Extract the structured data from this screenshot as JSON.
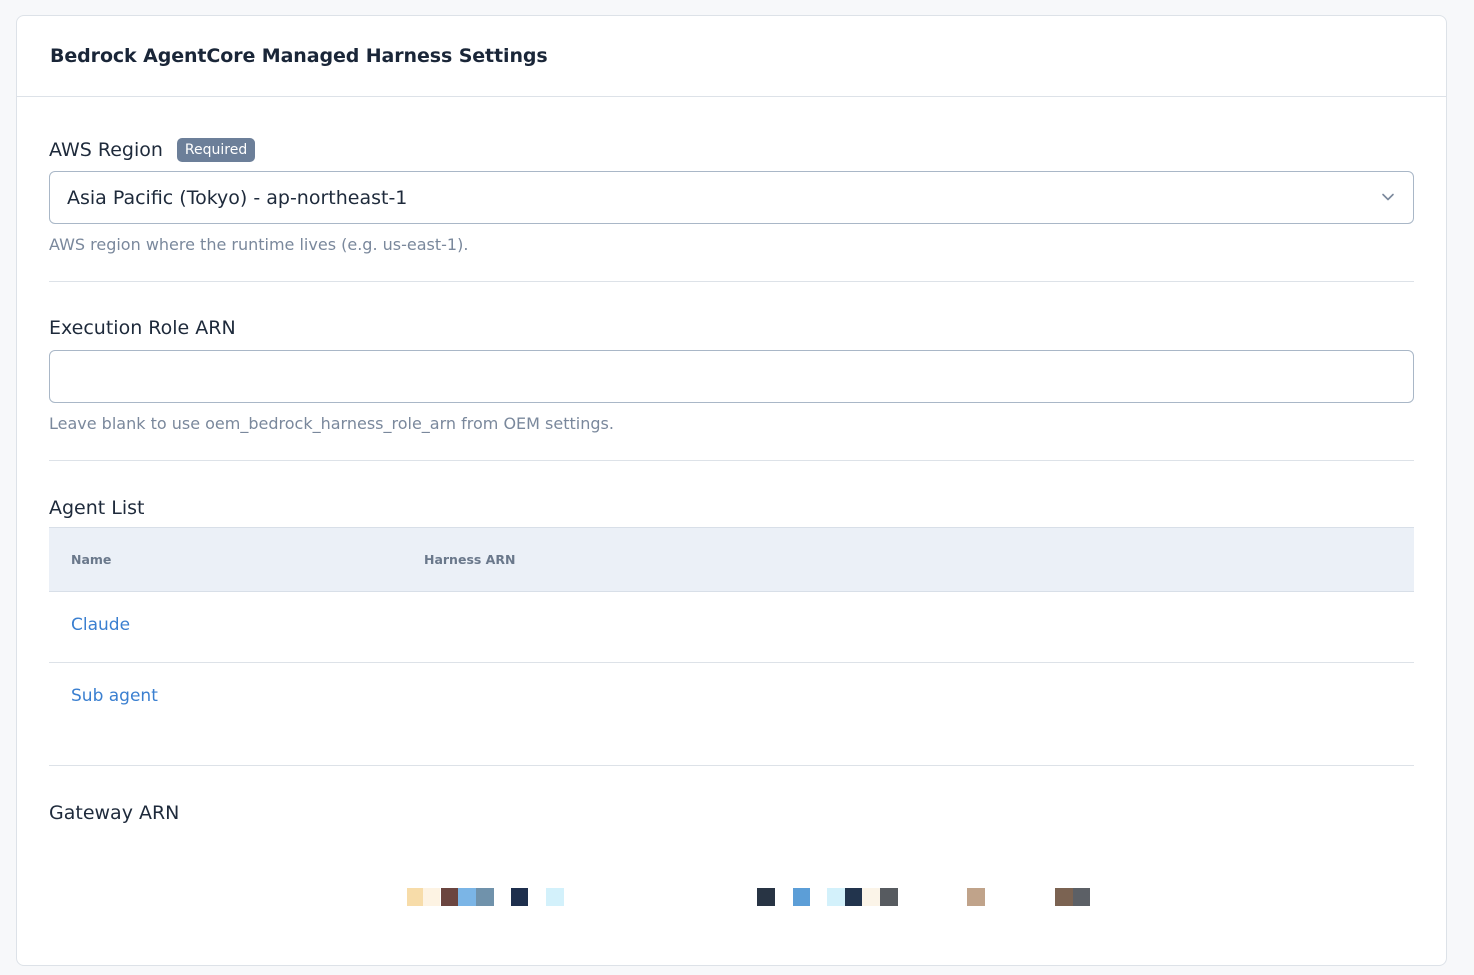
{
  "panel": {
    "title": "Bedrock AgentCore Managed Harness Settings"
  },
  "region": {
    "label": "AWS Region",
    "badge": "Required",
    "value": "Asia Pacific (Tokyo) - ap-northeast-1",
    "help": "AWS region where the runtime lives (e.g. us-east-1)."
  },
  "role": {
    "label": "Execution Role ARN",
    "value": "",
    "help": "Leave blank to use oem_bedrock_harness_role_arn from OEM settings."
  },
  "agents": {
    "label": "Agent List",
    "columns": [
      "Name",
      "Harness ARN"
    ],
    "rows": [
      {
        "name": "Claude",
        "arn": ""
      },
      {
        "name": "Sub agent",
        "arn": ""
      }
    ]
  },
  "gateway": {
    "label": "Gateway ARN"
  },
  "colors": {
    "accent_link": "#3a7fd0",
    "badge_bg": "#6c7f99",
    "table_header_bg": "#ebf0f7"
  }
}
